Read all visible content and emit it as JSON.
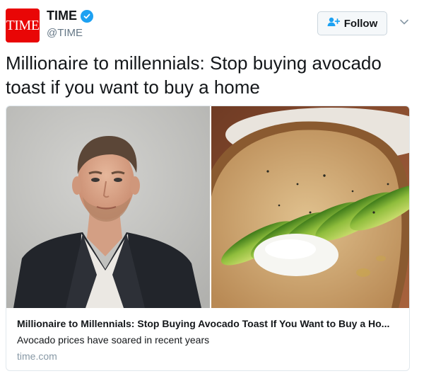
{
  "account": {
    "avatar_text": "TIME",
    "display_name": "TIME",
    "handle": "@TIME",
    "verified": true
  },
  "actions": {
    "follow_label": "Follow"
  },
  "tweet": {
    "text": "Millionaire to millennials: Stop buying avocado toast if you want to buy a home"
  },
  "card": {
    "title": "Millionaire to Millennials: Stop Buying Avocado Toast If You Want to Buy a Ho...",
    "description": "Avocado prices have soared in recent years",
    "domain": "time.com"
  },
  "icons": {
    "verified": "verified-badge-icon",
    "follow": "add-user-icon",
    "caret": "chevron-down-icon"
  },
  "colors": {
    "brand_red": "#e90606",
    "verified_blue": "#1da1f2",
    "muted_text": "#657786",
    "card_border": "#e1e8ed"
  }
}
